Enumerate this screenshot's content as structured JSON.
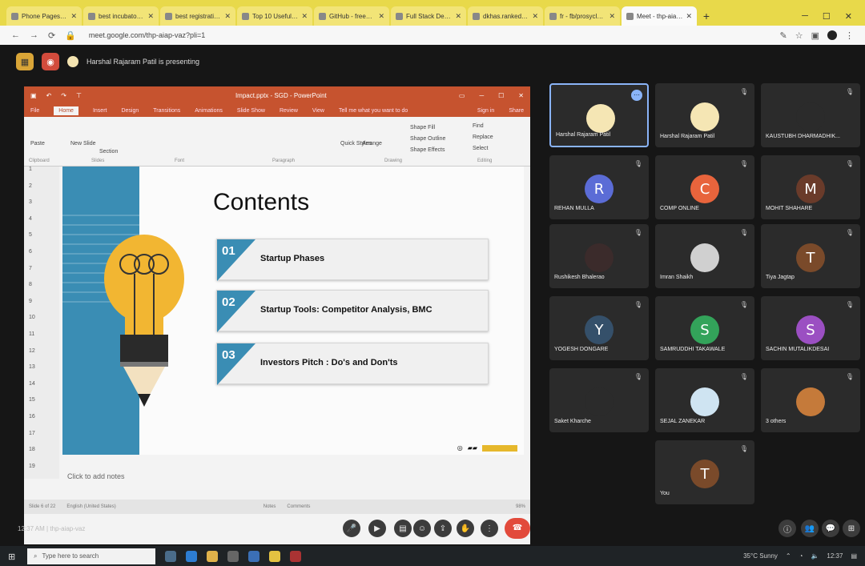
{
  "browser": {
    "tabs": [
      {
        "title": "Phone Pages - Select"
      },
      {
        "title": "best incubators in c"
      },
      {
        "title": "best registrations ar"
      },
      {
        "title": "Top 10 Useful Github"
      },
      {
        "title": "GitHub - freeCodeCa"
      },
      {
        "title": "Full Stack Developer"
      },
      {
        "title": "dkhas.rankedsheet"
      },
      {
        "title": "fr - fb/prosycleal@mit"
      },
      {
        "title": "Meet - thp-aiap-vaz"
      }
    ],
    "url": "meet.google.com/thp-aiap-vaz?pli=1"
  },
  "meet": {
    "presenting_text": "Harshal Rajaram Patil is presenting",
    "meeting_code": "thp-aiap-vaz",
    "time": "12:37 AM"
  },
  "powerpoint": {
    "title": "Impact.pptx - SGD - PowerPoint",
    "ribbon_tabs": [
      "File",
      "Home",
      "Insert",
      "Design",
      "Transitions",
      "Animations",
      "Slide Show",
      "Review",
      "View",
      "Tell me what you want to do"
    ],
    "ribbon_right": [
      "Sign in",
      "Share"
    ],
    "tools": {
      "find": "Find",
      "replace": "Replace",
      "select": "Select",
      "paste": "Paste",
      "new_slide": "New Slide",
      "section": "Section",
      "arrange": "Arrange",
      "quick_styles": "Quick Styles",
      "shape_fill": "Shape Fill",
      "shape_outline": "Shape Outline",
      "shape_effects": "Shape Effects"
    },
    "groups": [
      "Clipboard",
      "Slides",
      "Font",
      "Paragraph",
      "Drawing",
      "Editing"
    ],
    "thumbnail_numbers": [
      "1",
      "2",
      "3",
      "4",
      "5",
      "6",
      "7",
      "8",
      "9",
      "10",
      "11",
      "12",
      "13",
      "14",
      "15",
      "16",
      "17",
      "18",
      "19"
    ],
    "slide": {
      "title": "Contents",
      "items": [
        {
          "num": "01",
          "label": "Startup Phases"
        },
        {
          "num": "02",
          "label": "Startup Tools: Competitor Analysis, BMC"
        },
        {
          "num": "03",
          "label": "Investors Pitch : Do's and Don'ts"
        }
      ]
    },
    "notes_placeholder": "Click to add notes",
    "status": {
      "slide_of": "Slide 6 of 22",
      "language": "English (United States)",
      "notes": "Notes",
      "comments": "Comments",
      "zoom": "98%"
    }
  },
  "participants": [
    {
      "name": "Harshal Rajaram Patil",
      "initial": "",
      "color": "#f5e6b4",
      "selected": true
    },
    {
      "name": "Harshal Rajaram Patil",
      "initial": "",
      "color": "#f5e6b4",
      "selected": false
    },
    {
      "name": "KAUSTUBH DHARMADHIK...",
      "initial": "",
      "color": "#2b2b2b",
      "selected": false
    },
    {
      "name": "REHAN MULLA",
      "initial": "R",
      "color": "#5b6cd6",
      "selected": false
    },
    {
      "name": "COMP ONLINE",
      "initial": "C",
      "color": "#e8643c",
      "selected": false
    },
    {
      "name": "MOHIT SHAHARE",
      "initial": "M",
      "color": "#6a3b2a",
      "selected": false
    },
    {
      "name": "Rushikesh Bhalerao",
      "initial": "",
      "color": "#3b2b2b",
      "selected": false
    },
    {
      "name": "Imran Shaikh",
      "initial": "",
      "color": "#d0d0d0",
      "selected": false
    },
    {
      "name": "Tiya Jagtap",
      "initial": "T",
      "color": "#7a4a2a",
      "selected": false
    },
    {
      "name": "YOGESH DONGARE",
      "initial": "Y",
      "color": "#35506a",
      "selected": false
    },
    {
      "name": "SAMRUDDHI TAKAWALE",
      "initial": "S",
      "color": "#33a35a",
      "selected": false
    },
    {
      "name": "SACHIN MUTALIKDESAI",
      "initial": "S",
      "color": "#9b4fc2",
      "selected": false
    },
    {
      "name": "Saket Kharche",
      "initial": "",
      "color": "#2b2b2b",
      "selected": false
    },
    {
      "name": "SEJAL ZANEKAR",
      "initial": "",
      "color": "#cfe4f2",
      "selected": false
    },
    {
      "name": "3 others",
      "initial": "",
      "color": "#c57a3a",
      "selected": false
    },
    {
      "name": "You",
      "initial": "T",
      "color": "#7a4a2a",
      "selected": false
    }
  ],
  "taskbar": {
    "search_placeholder": "Type here to search",
    "weather": "35°C Sunny",
    "clock": "12:37"
  }
}
